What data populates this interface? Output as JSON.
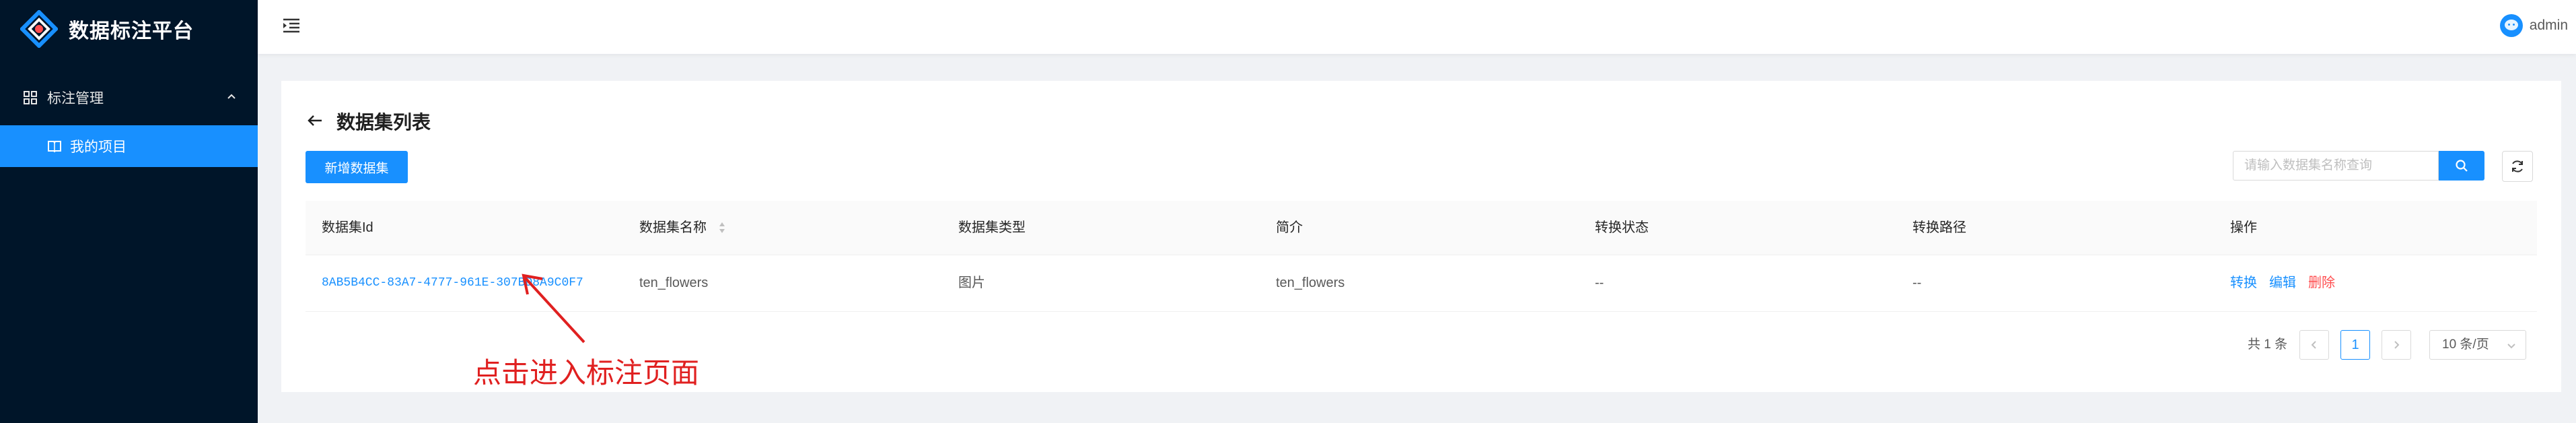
{
  "sidebar": {
    "app_title": "数据标注平台",
    "menu_group_label": "标注管理",
    "menu_item_label": "我的项目"
  },
  "header": {
    "user_name": "admin"
  },
  "page": {
    "title": "数据集列表",
    "add_button": "新增数据集",
    "search_placeholder": "请输入数据集名称查询"
  },
  "table": {
    "columns": [
      "数据集Id",
      "数据集名称",
      "数据集类型",
      "简介",
      "转换状态",
      "转换路径",
      "操作"
    ],
    "rows": [
      {
        "id": "8AB5B4CC-83A7-4777-961E-307BD8A9C0F7",
        "name": "ten_flowers",
        "type": "图片",
        "intro": "ten_flowers",
        "status": "--",
        "path": "--",
        "actions": [
          "转换",
          "编辑",
          "删除"
        ]
      }
    ]
  },
  "pagination": {
    "total_text": "共 1 条",
    "current_page": "1",
    "page_size": "10 条/页"
  },
  "annotation": {
    "text": "点击进入标注页面",
    "color": "#e02020"
  },
  "colors": {
    "primary": "#1890ff",
    "sidebar_bg": "#001529",
    "danger": "#ff4d4f"
  }
}
